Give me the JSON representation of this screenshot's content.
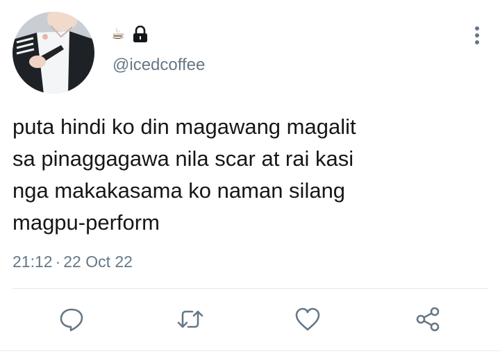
{
  "profile": {
    "display_name": "☕",
    "handle": "@icedcoffee",
    "protected_icon": "lock-icon",
    "avatar_icon": "profile-photo"
  },
  "menu": {
    "icon": "vertical-ellipsis-icon"
  },
  "tweet": {
    "text": "puta hindi ko din magawang magalit\nsa pinaggagawa nila scar at rai kasi\nnga makakasama ko naman silang\nmagpu-perform",
    "time": "21:12",
    "separator": "·",
    "date": "22 Oct 22"
  },
  "actions": [
    {
      "name": "reply",
      "icon": "reply-icon"
    },
    {
      "name": "retweet",
      "icon": "retweet-icon"
    },
    {
      "name": "like",
      "icon": "heart-icon"
    },
    {
      "name": "share",
      "icon": "share-icon"
    }
  ],
  "colors": {
    "text_primary": "#14171a",
    "text_secondary": "#657786",
    "icon": "#657786",
    "divider": "#e1e8ed"
  }
}
